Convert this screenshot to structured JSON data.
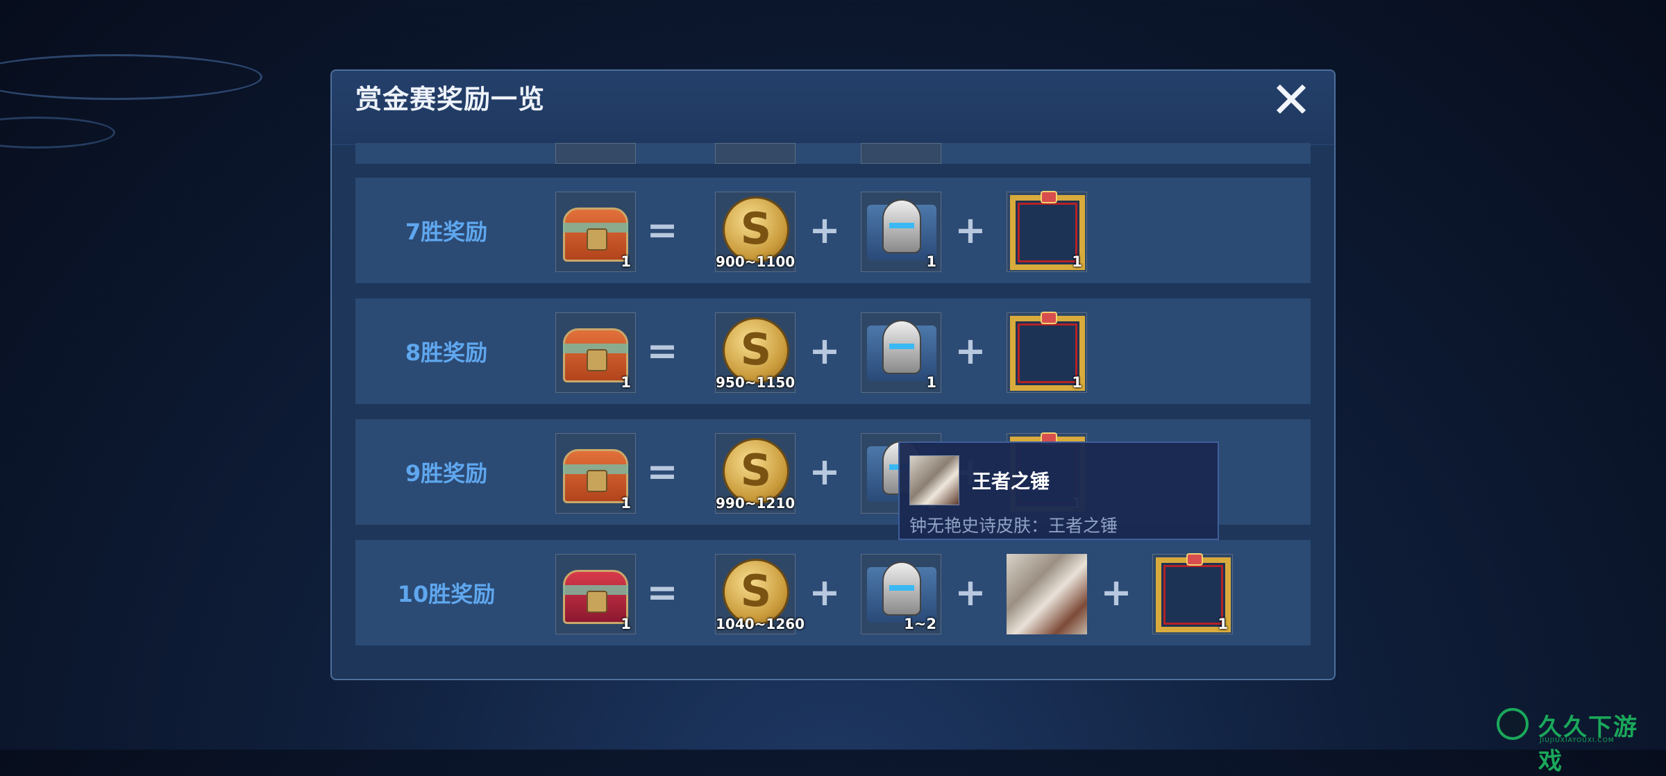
{
  "dialog": {
    "title": "赏金赛奖励一览",
    "close_icon": "close-icon"
  },
  "rows": [
    {
      "label": "7胜奖励",
      "chest_qty": "1",
      "coins": "900~1100",
      "helmet_qty": "1",
      "frame_qty": "1"
    },
    {
      "label": "8胜奖励",
      "chest_qty": "1",
      "coins": "950~1150",
      "helmet_qty": "1",
      "frame_qty": "1"
    },
    {
      "label": "9胜奖励",
      "chest_qty": "1",
      "coins": "990~1210",
      "helmet_qty": "1",
      "frame_qty": "1"
    },
    {
      "label": "10胜奖励",
      "chest_qty": "1",
      "coins": "1040~1260",
      "helmet_qty": "1~2",
      "frame_qty": "1"
    }
  ],
  "operators": {
    "equals": "=",
    "plus": "+"
  },
  "tooltip": {
    "name": "王者之锤",
    "description": "钟无艳史诗皮肤：王者之锤"
  },
  "watermark": {
    "text": "久久下游戏",
    "sub": "JIUJIUXIAYOUXI.COM"
  },
  "colors": {
    "label": "#5fa7ee",
    "row_bg": "#2b4a74",
    "panel_bg": "#1d3659"
  }
}
